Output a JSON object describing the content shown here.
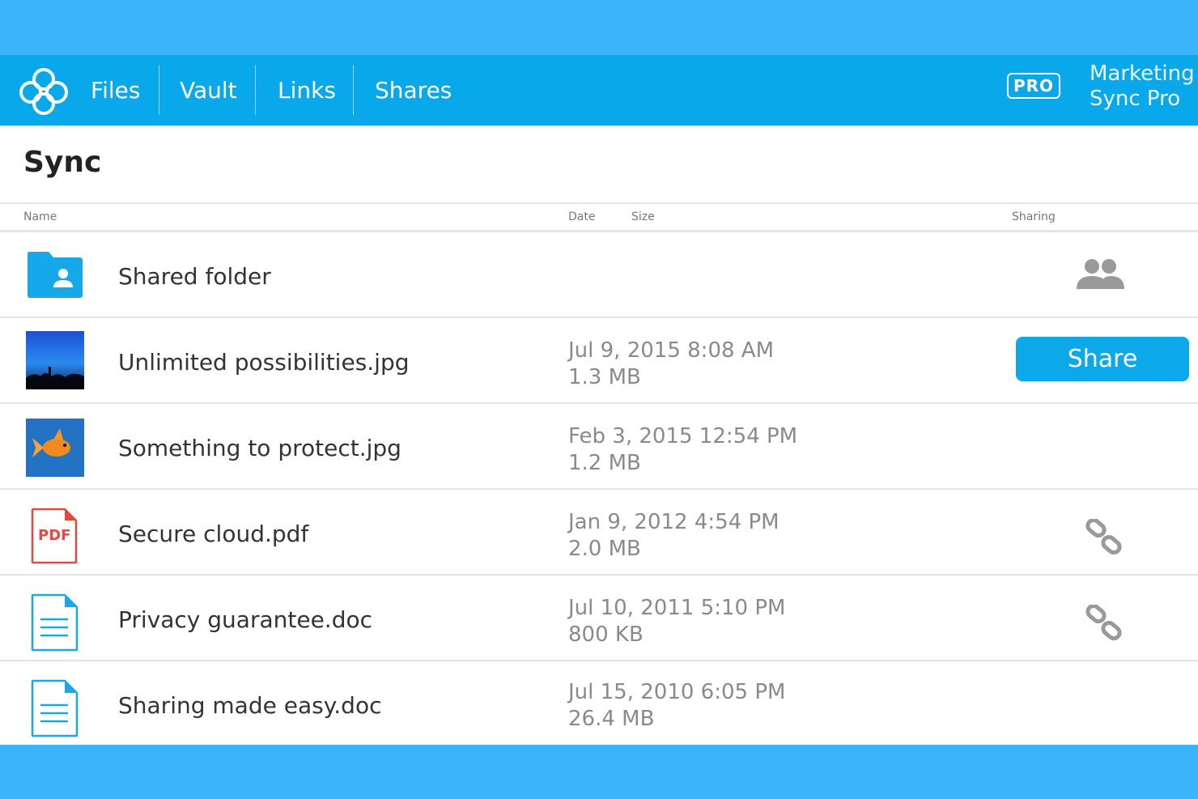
{
  "header": {
    "nav": [
      "Files",
      "Vault",
      "Links",
      "Shares"
    ],
    "badge": "PRO",
    "account": {
      "name": "Marketing D",
      "plan": "Sync Pro"
    }
  },
  "page": {
    "title": "Sync"
  },
  "columns": {
    "name": "Name",
    "date": "Date",
    "size": "Size",
    "sharing": "Sharing"
  },
  "files": [
    {
      "name": "Shared folder",
      "date": "",
      "size": "",
      "icon": "shared-folder-icon",
      "sharing": "people-icon"
    },
    {
      "name": "Unlimited possibilities.jpg",
      "date": "Jul 9, 2015  8:08 AM",
      "size": "1.3 MB",
      "icon": "image-thumbnail",
      "sharing": "share-button",
      "share_label": "Share"
    },
    {
      "name": "Something to protect.jpg",
      "date": "Feb 3, 2015  12:54 PM",
      "size": "1.2 MB",
      "icon": "image-thumbnail",
      "sharing": ""
    },
    {
      "name": "Secure cloud.pdf",
      "date": "Jan 9, 2012  4:54 PM",
      "size": "2.0 MB",
      "icon": "pdf-icon",
      "icon_label": "PDF",
      "sharing": "link-icon"
    },
    {
      "name": "Privacy guarantee.doc",
      "date": "Jul 10, 2011  5:10 PM",
      "size": "800 KB",
      "icon": "document-icon",
      "sharing": "link-icon"
    },
    {
      "name": "Sharing made easy.doc",
      "date": "Jul 15, 2010  6:05 PM",
      "size": "26.4 MB",
      "icon": "document-icon",
      "sharing": ""
    }
  ],
  "colors": {
    "outer_bg": "#3bb4fb",
    "topbar": "#08a8ea",
    "accent": "#0ba8ea",
    "pdf_red": "#e04a3f"
  }
}
